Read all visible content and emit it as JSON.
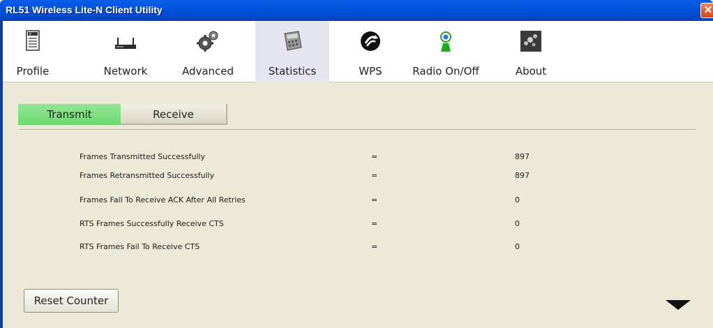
{
  "window": {
    "title": "RL51 Wireless Lite-N Client Utility"
  },
  "toolbar": {
    "items": [
      {
        "label": "Profile",
        "icon": "profile-icon"
      },
      {
        "label": "Network",
        "icon": "network-router-icon"
      },
      {
        "label": "Advanced",
        "icon": "advanced-gears-icon"
      },
      {
        "label": "Statistics",
        "icon": "statistics-calculator-icon",
        "active": true
      },
      {
        "label": "WPS",
        "icon": "wps-icon"
      },
      {
        "label": "Radio On/Off",
        "icon": "radio-antenna-icon"
      },
      {
        "label": "About",
        "icon": "about-icon"
      }
    ]
  },
  "tabs": {
    "transmit": "Transmit",
    "receive": "Receive",
    "active": "Transmit"
  },
  "stats": [
    {
      "name": "Frames Transmitted Successfully",
      "eq": "=",
      "value": "897"
    },
    {
      "name": "Frames Retransmitted Successfully",
      "eq": "=",
      "value": "897"
    },
    {
      "name": "Frames Fail To Receive ACK After All Retries",
      "eq": "=",
      "value": "0"
    },
    {
      "name": "RTS Frames Successfully Receive CTS",
      "eq": "=",
      "value": "0"
    },
    {
      "name": "RTS Frames Fail To Receive CTS",
      "eq": "=",
      "value": "0"
    }
  ],
  "buttons": {
    "reset": "Reset Counter"
  },
  "colors": {
    "titlebar": "#0050d8",
    "active_tab": "#6bd96e",
    "active_toolbar": "#e6e6f3"
  }
}
